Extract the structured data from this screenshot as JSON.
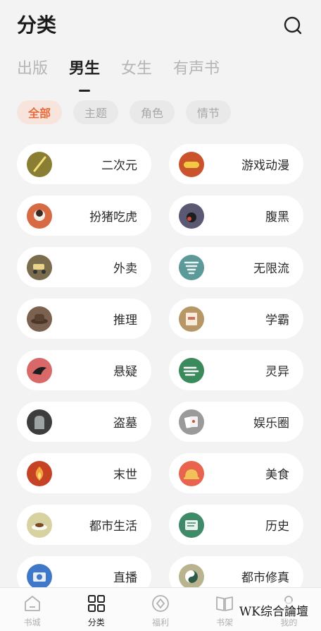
{
  "header": {
    "title": "分类",
    "search_icon": "search-icon"
  },
  "tabs": [
    {
      "label": "出版",
      "active": false
    },
    {
      "label": "男生",
      "active": true
    },
    {
      "label": "女生",
      "active": false
    },
    {
      "label": "有声书",
      "active": false
    }
  ],
  "filters": [
    {
      "label": "全部",
      "active": true
    },
    {
      "label": "主题",
      "active": false
    },
    {
      "label": "角色",
      "active": false
    },
    {
      "label": "情节",
      "active": false
    }
  ],
  "categories": [
    {
      "label": "二次元",
      "icon": "sword-icon",
      "color": "#8a7d34"
    },
    {
      "label": "游戏动漫",
      "icon": "gamepad-icon",
      "color": "#c9532a"
    },
    {
      "label": "扮猪吃虎",
      "icon": "pig-icon",
      "color": "#d86a43"
    },
    {
      "label": "腹黑",
      "icon": "bomb-icon",
      "color": "#5a5872"
    },
    {
      "label": "外卖",
      "icon": "scooter-icon",
      "color": "#7a6c4c"
    },
    {
      "label": "无限流",
      "icon": "tornado-icon",
      "color": "#5b9a98"
    },
    {
      "label": "推理",
      "icon": "detective-hat-icon",
      "color": "#7b6250"
    },
    {
      "label": "学霸",
      "icon": "certificate-icon",
      "color": "#b89767"
    },
    {
      "label": "悬疑",
      "icon": "crow-icon",
      "color": "#d96868"
    },
    {
      "label": "灵异",
      "icon": "ghost-wind-icon",
      "color": "#3a8a5c"
    },
    {
      "label": "盗墓",
      "icon": "tombstone-icon",
      "color": "#3d3d3d"
    },
    {
      "label": "娱乐圈",
      "icon": "playing-cards-icon",
      "color": "#9a9a9a"
    },
    {
      "label": "末世",
      "icon": "fire-icon",
      "color": "#c54324"
    },
    {
      "label": "美食",
      "icon": "cloche-icon",
      "color": "#e8644f"
    },
    {
      "label": "都市生活",
      "icon": "coffee-cup-icon",
      "color": "#d8d2a0"
    },
    {
      "label": "历史",
      "icon": "scroll-icon",
      "color": "#3f8a68"
    },
    {
      "label": "直播",
      "icon": "camera-icon",
      "color": "#3f78c8"
    },
    {
      "label": "都市修真",
      "icon": "yin-yang-icon",
      "color": "#b9b48e"
    }
  ],
  "bottom_nav": [
    {
      "label": "书城",
      "icon": "home-icon",
      "active": false
    },
    {
      "label": "分类",
      "icon": "grid-icon",
      "active": true
    },
    {
      "label": "福利",
      "icon": "gift-icon",
      "active": false
    },
    {
      "label": "书架",
      "icon": "book-icon",
      "active": false
    },
    {
      "label": "我的",
      "icon": "user-icon",
      "active": false
    }
  ],
  "watermark": "WK综合論壇"
}
